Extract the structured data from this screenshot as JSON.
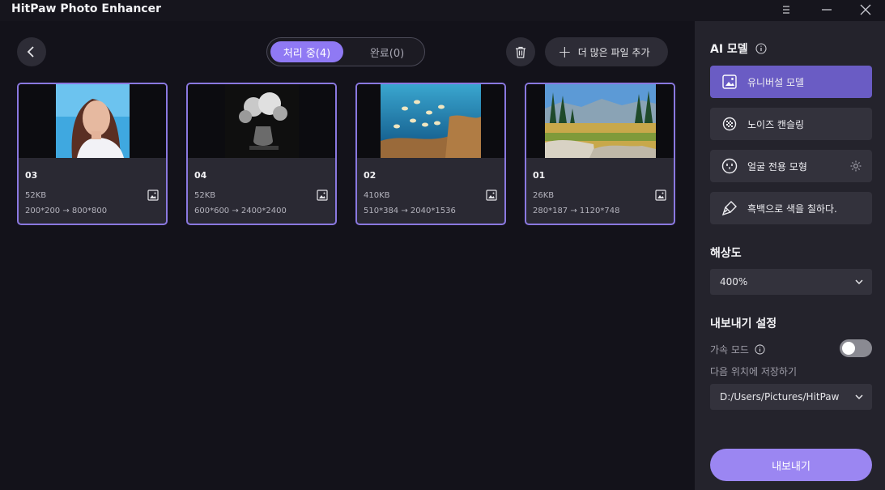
{
  "app": {
    "title": "HitPaw Photo Enhancer"
  },
  "toolbar": {
    "tabs": [
      {
        "label": "처리 중(4)",
        "active": true
      },
      {
        "label": "완료(0)",
        "active": false
      }
    ],
    "add_files_label": "더 많은 파일 추가"
  },
  "files": [
    {
      "name": "03",
      "size": "52KB",
      "dims": "200*200 → 800*800"
    },
    {
      "name": "04",
      "size": "52KB",
      "dims": "600*600 → 2400*2400"
    },
    {
      "name": "02",
      "size": "410KB",
      "dims": "510*384 → 2040*1536"
    },
    {
      "name": "01",
      "size": "26KB",
      "dims": "280*187 → 1120*748"
    }
  ],
  "panel": {
    "ai_model_title": "AI 모델",
    "models": [
      {
        "label": "유니버설 모델",
        "icon": "image-icon",
        "selected": true
      },
      {
        "label": "노이즈 캔슬링",
        "icon": "noise-icon",
        "selected": false
      },
      {
        "label": "얼굴 전용 모형",
        "icon": "face-icon",
        "selected": false
      },
      {
        "label": "흑백으로 색을 칠하다.",
        "icon": "brush-icon",
        "selected": false
      }
    ],
    "resolution_title": "해상도",
    "resolution_value": "400%",
    "export_settings_title": "내보내기 설정",
    "accel_mode_label": "가속 모드",
    "accel_mode_on": false,
    "save_location_label": "다음 위치에 저장하기",
    "save_path": "D:/Users/Pictures/HitPaw",
    "export_button": "내보내기"
  },
  "colors": {
    "accent": "#8f79f4",
    "selected_model": "#6a5cc4",
    "panel_bg": "#24232c",
    "main_bg": "#13121a"
  }
}
